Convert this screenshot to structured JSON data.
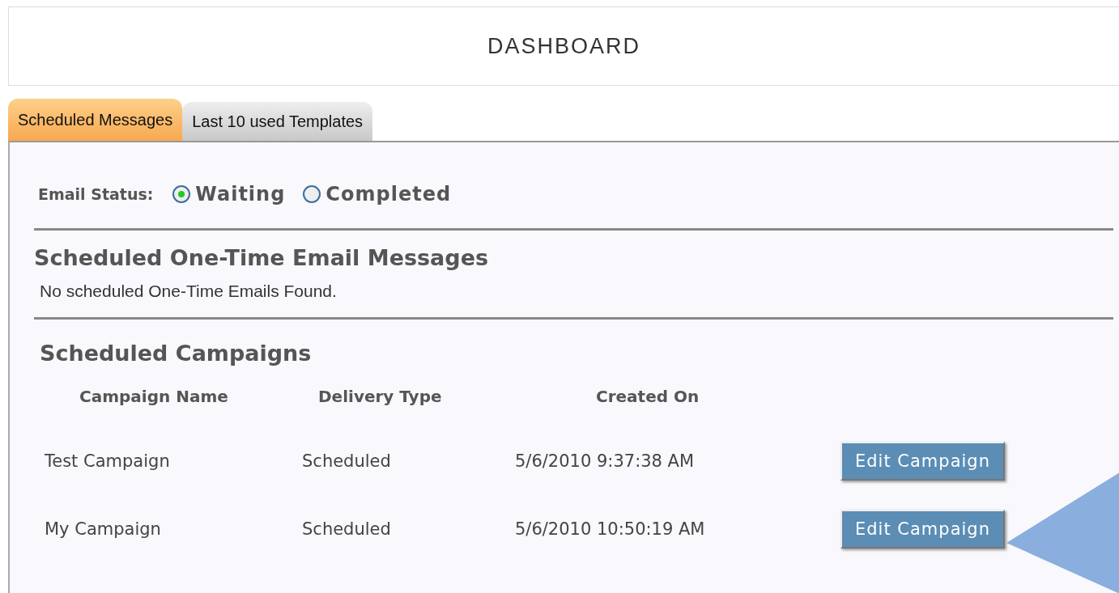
{
  "header": {
    "title": "DASHBOARD"
  },
  "tabs": [
    {
      "label": "Scheduled Messages",
      "selected": true
    },
    {
      "label": "Last 10 used Templates",
      "selected": false
    }
  ],
  "email_status": {
    "label": "Email Status:",
    "options": [
      {
        "label": "Waiting",
        "selected": true
      },
      {
        "label": "Completed",
        "selected": false
      }
    ]
  },
  "one_time": {
    "heading": "Scheduled One-Time Email Messages",
    "message": "No scheduled One-Time Emails Found."
  },
  "campaigns": {
    "heading": "Scheduled Campaigns",
    "columns": [
      "Campaign Name",
      "Delivery Type",
      "Created On"
    ],
    "rows": [
      {
        "name": "Test Campaign",
        "delivery_type": "Scheduled",
        "created_on": "5/6/2010 9:37:38 AM",
        "action": "Edit Campaign"
      },
      {
        "name": "My Campaign",
        "delivery_type": "Scheduled",
        "created_on": "5/6/2010 10:50:19 AM",
        "action": "Edit Campaign"
      }
    ]
  }
}
